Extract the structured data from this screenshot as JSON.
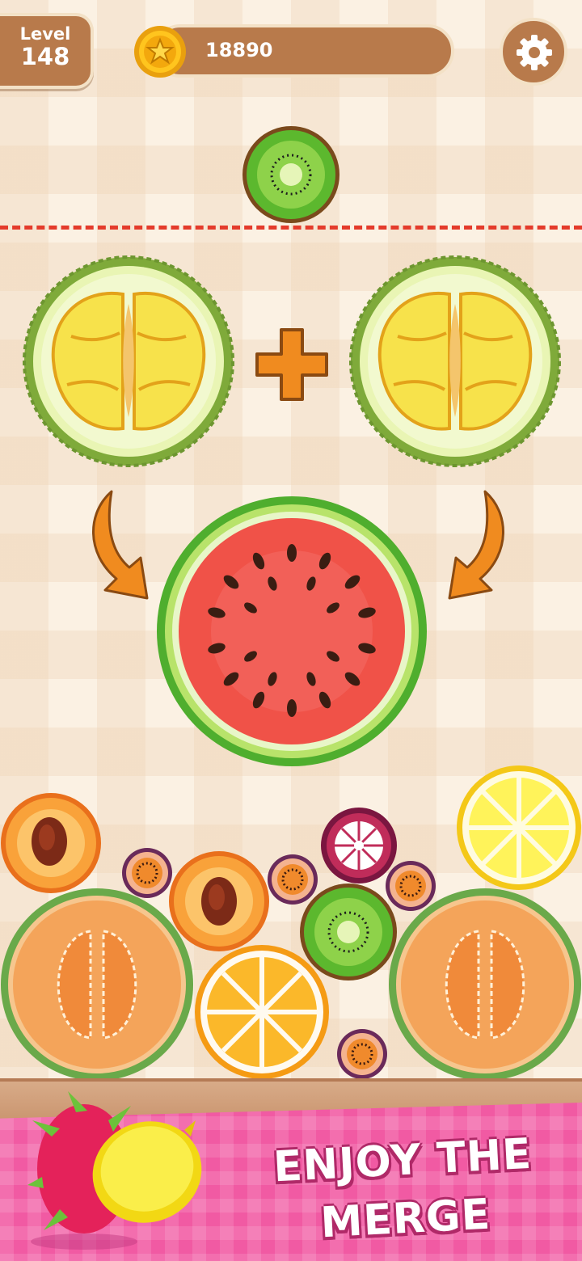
{
  "hud": {
    "level_label": "Level",
    "level_value": "148",
    "coins": "18890",
    "settings_icon": "gear-icon",
    "coin_icon": "star-coin-icon"
  },
  "colors": {
    "hud_brown": "#b87a4b",
    "danger_line": "#e43b2b",
    "arrow_orange": "#f08b1f",
    "banner_pink": "#f15aa3"
  },
  "tutorial": {
    "left_fruit": "durian",
    "right_fruit": "durian",
    "operator_icon": "plus-icon",
    "result_fruit": "watermelon",
    "arrow_icons": [
      "curved-arrow-down-right-icon",
      "curved-arrow-down-left-icon"
    ]
  },
  "next_fruit": "kiwi",
  "board_fruits": [
    "peach",
    "passion-fruit",
    "peach",
    "passion-fruit",
    "mangosteen",
    "lemon",
    "passion-fruit",
    "kiwi",
    "cantaloupe",
    "orange",
    "cantaloupe",
    "passion-fruit"
  ],
  "banner": {
    "tagline_line1": "ENJOY THE",
    "tagline_line2": "MERGE",
    "decor_fruits": [
      "dragon-fruit",
      "lemon"
    ]
  }
}
